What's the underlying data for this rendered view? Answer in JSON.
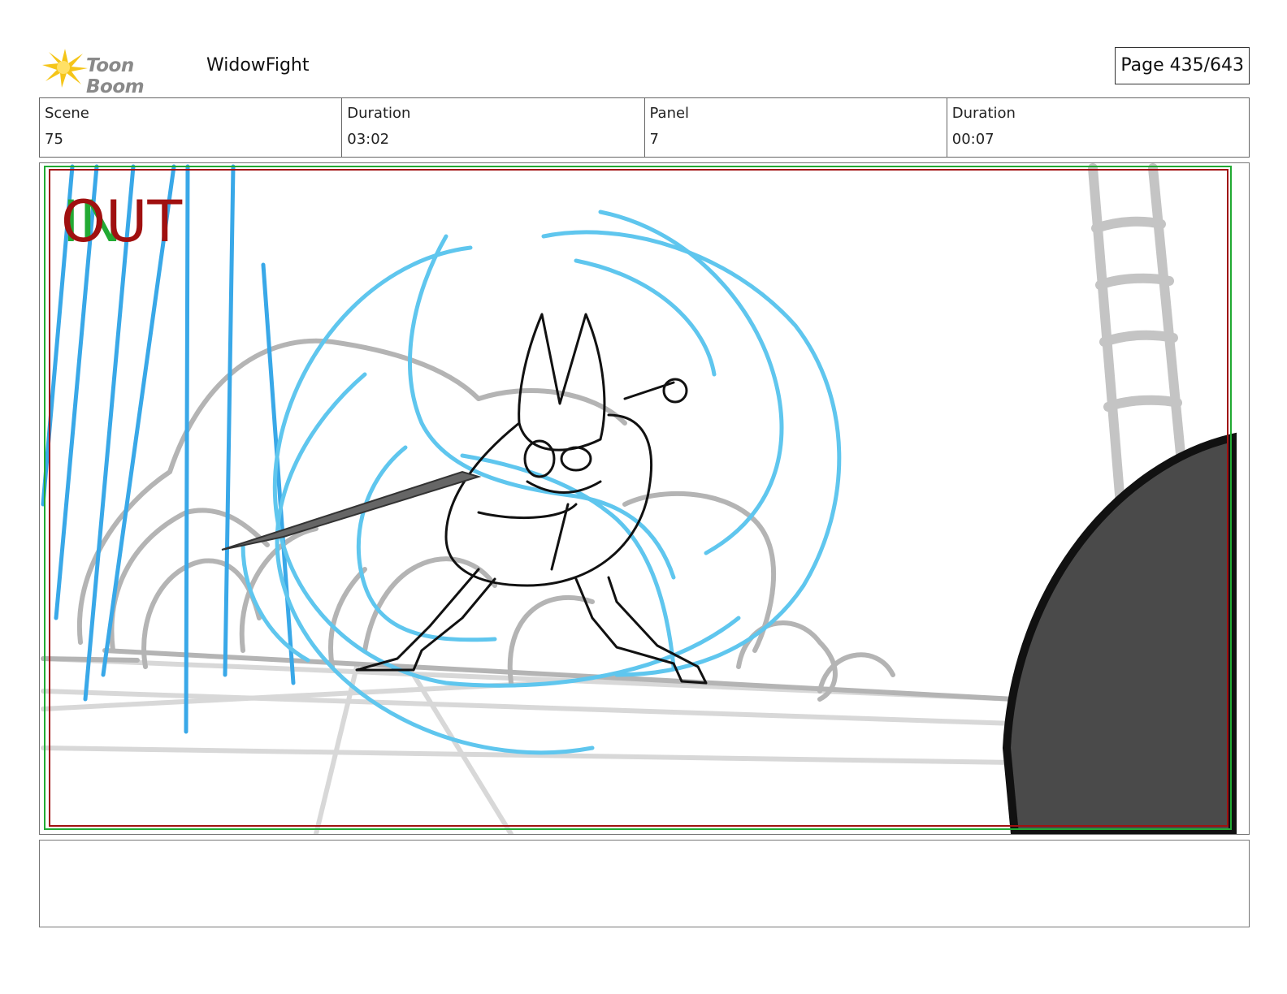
{
  "header": {
    "logo_text": "Toon Boom",
    "project_title": "WidowFight",
    "page_number": "Page 435/643"
  },
  "info": {
    "scene_label": "Scene",
    "scene_value": "75",
    "duration_label": "Duration",
    "duration_value": "03:02",
    "panel_label": "Panel",
    "panel_value": "7",
    "panel_duration_label": "Duration",
    "panel_duration_value": "00:07"
  },
  "panel_overlay": {
    "in_label": "IN",
    "out_label": "OUT"
  },
  "notes": {
    "text": ""
  },
  "colors": {
    "out_red": "#a01010",
    "in_green": "#22aa33",
    "blue_stroke": "#39a8e8",
    "light_blue": "#5fc6ee",
    "sketch_gray": "#b4b4b4",
    "shadow_fill": "#4a4a4a"
  }
}
